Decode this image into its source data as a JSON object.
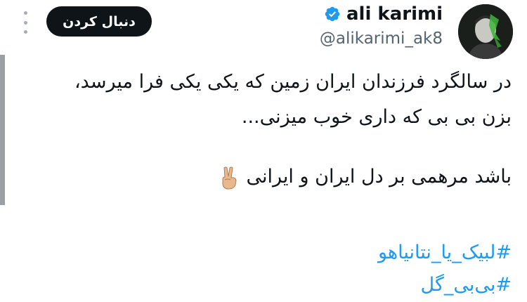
{
  "header": {
    "display_name": "ali karimi",
    "handle": "@alikarimi_ak8",
    "follow_label": "دنبال کردن",
    "verified": true,
    "avatar_icon": "profile-photo"
  },
  "menu": {
    "icon": "kebab-vertical-icon"
  },
  "tweet": {
    "lines": [
      "در سالگرد فرزندان ایران زمین که یکی یکی فرا میرسد،",
      "بزن بی بی که داری خوب میزنی...",
      "باشد مرهمی بر دل ایران و ایرانی"
    ],
    "emoji": "victory-hand-icon",
    "hashtags": [
      "#لبیک_یا_نتانیاهو",
      "#بی‌بی_گل"
    ]
  },
  "colors": {
    "text": "#0f1419",
    "secondary_text": "#536471",
    "link": "#1d9bf0",
    "button_bg": "#0f1419",
    "verified_badge": "#1d9bf0"
  }
}
